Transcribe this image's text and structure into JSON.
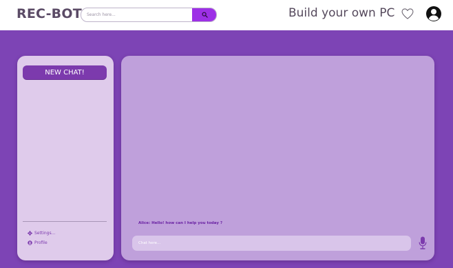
{
  "header": {
    "brand": "REC-BOT",
    "search": {
      "placeholder": "Search here...",
      "value": ""
    },
    "tagline": "Build your own PC"
  },
  "sidebar": {
    "new_chat_label": "NEW CHAT!",
    "links": [
      {
        "label": "Settings...",
        "icon": "gear-icon"
      },
      {
        "label": "Profile",
        "icon": "user-circle-icon"
      }
    ]
  },
  "chat": {
    "messages": [
      {
        "text": "Alice: Hello! how can I help you today ?"
      }
    ],
    "input": {
      "placeholder": "Chat here...",
      "value": ""
    }
  },
  "colors": {
    "background": "#7d44b5",
    "accent": "#9d30e6",
    "sidebar_bg": "#dfcbeb",
    "chat_bg": "#bfa0db",
    "button": "#7c3aad"
  }
}
